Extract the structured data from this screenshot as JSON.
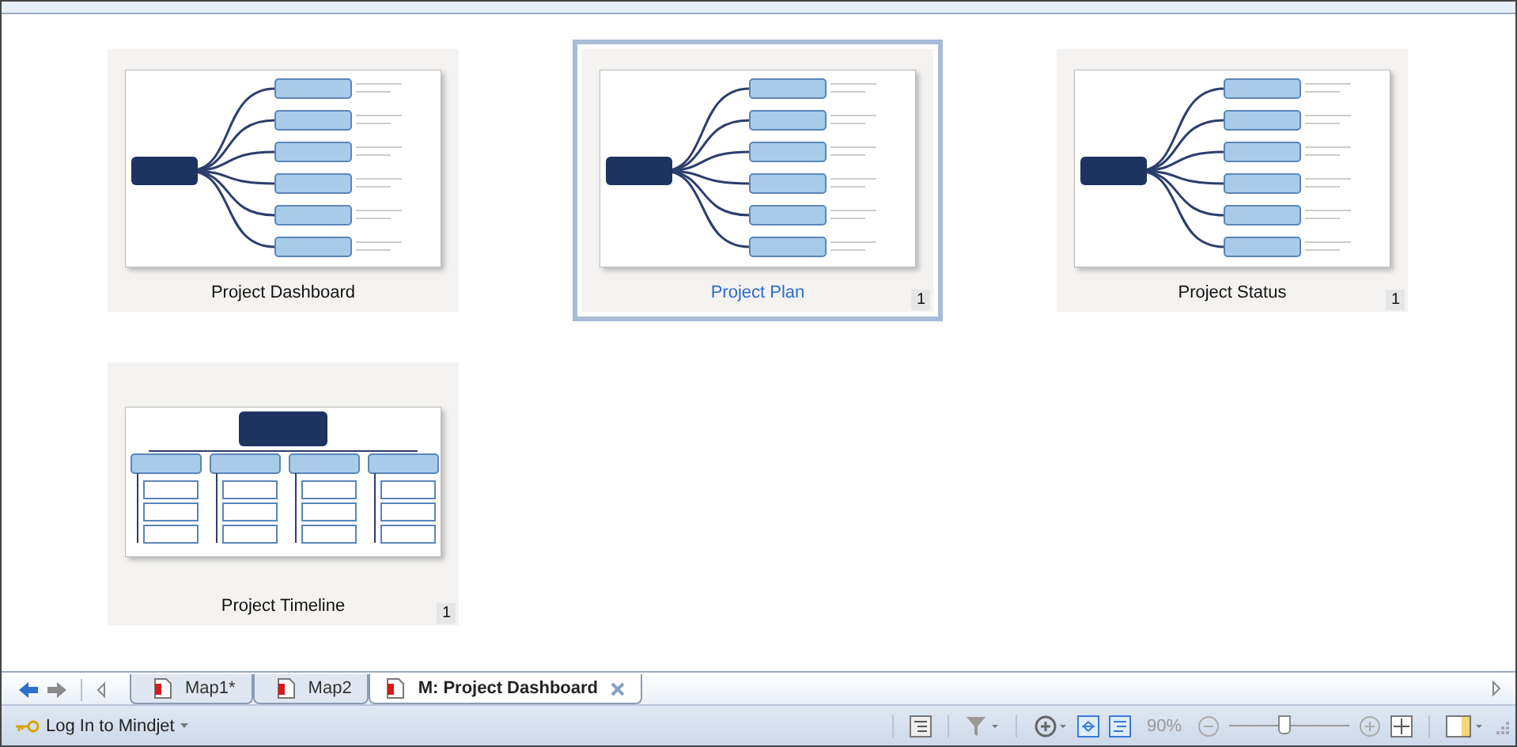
{
  "cards": [
    {
      "title": "Project Dashboard",
      "selected": false,
      "kind": "mindmap"
    },
    {
      "title": "Project Plan",
      "selected": true,
      "kind": "mindmap",
      "badge": "1"
    },
    {
      "title": "Project Status",
      "selected": false,
      "kind": "mindmap",
      "badge": "1"
    },
    {
      "title": "Project Timeline",
      "selected": false,
      "kind": "orgchart",
      "badge": "1"
    }
  ],
  "tabs": [
    {
      "label": "Map1*",
      "selected": false
    },
    {
      "label": "Map2",
      "selected": false
    },
    {
      "label": "M: Project Dashboard",
      "selected": true
    }
  ],
  "status_bar": {
    "login": "Log In to Mindjet",
    "zoom": "90%",
    "zoom_slider": {
      "level": 0.45
    }
  }
}
